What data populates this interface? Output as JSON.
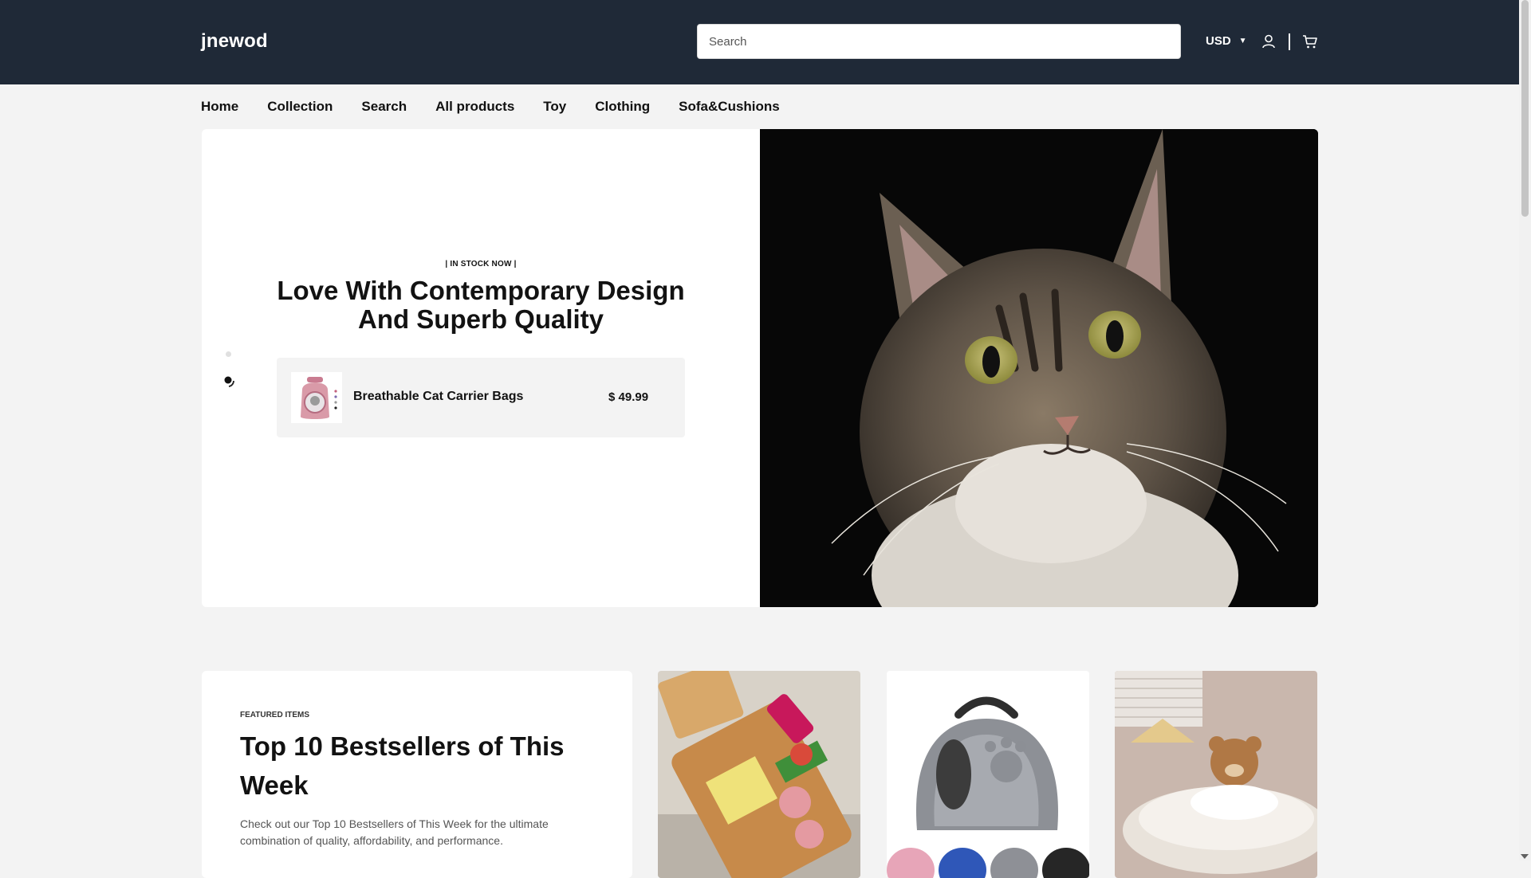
{
  "header": {
    "logo": "jnewod",
    "search_placeholder": "Search",
    "currency": "USD",
    "icons": [
      "account-icon",
      "cart-icon"
    ]
  },
  "nav": {
    "items": [
      {
        "label": "Home"
      },
      {
        "label": "Collection"
      },
      {
        "label": "Search"
      },
      {
        "label": "All products"
      },
      {
        "label": "Toy"
      },
      {
        "label": "Clothing"
      },
      {
        "label": "Sofa&Cushions"
      }
    ]
  },
  "hero": {
    "badge": "| IN STOCK NOW |",
    "title": "Love With Contemporary Design And Superb Quality",
    "product": {
      "name": "Breathable Cat Carrier Bags",
      "price": "$ 49.99"
    }
  },
  "featured": {
    "eyebrow": "FEATURED ITEMS",
    "title": "Top 10 Bestsellers of This Week",
    "description": "Check out our Top 10 Bestsellers of This Week for the ultimate combination of quality, affordability, and performance."
  },
  "colors": {
    "header_bg": "#1f2937",
    "page_bg": "#f3f3f3",
    "text": "#121212"
  }
}
